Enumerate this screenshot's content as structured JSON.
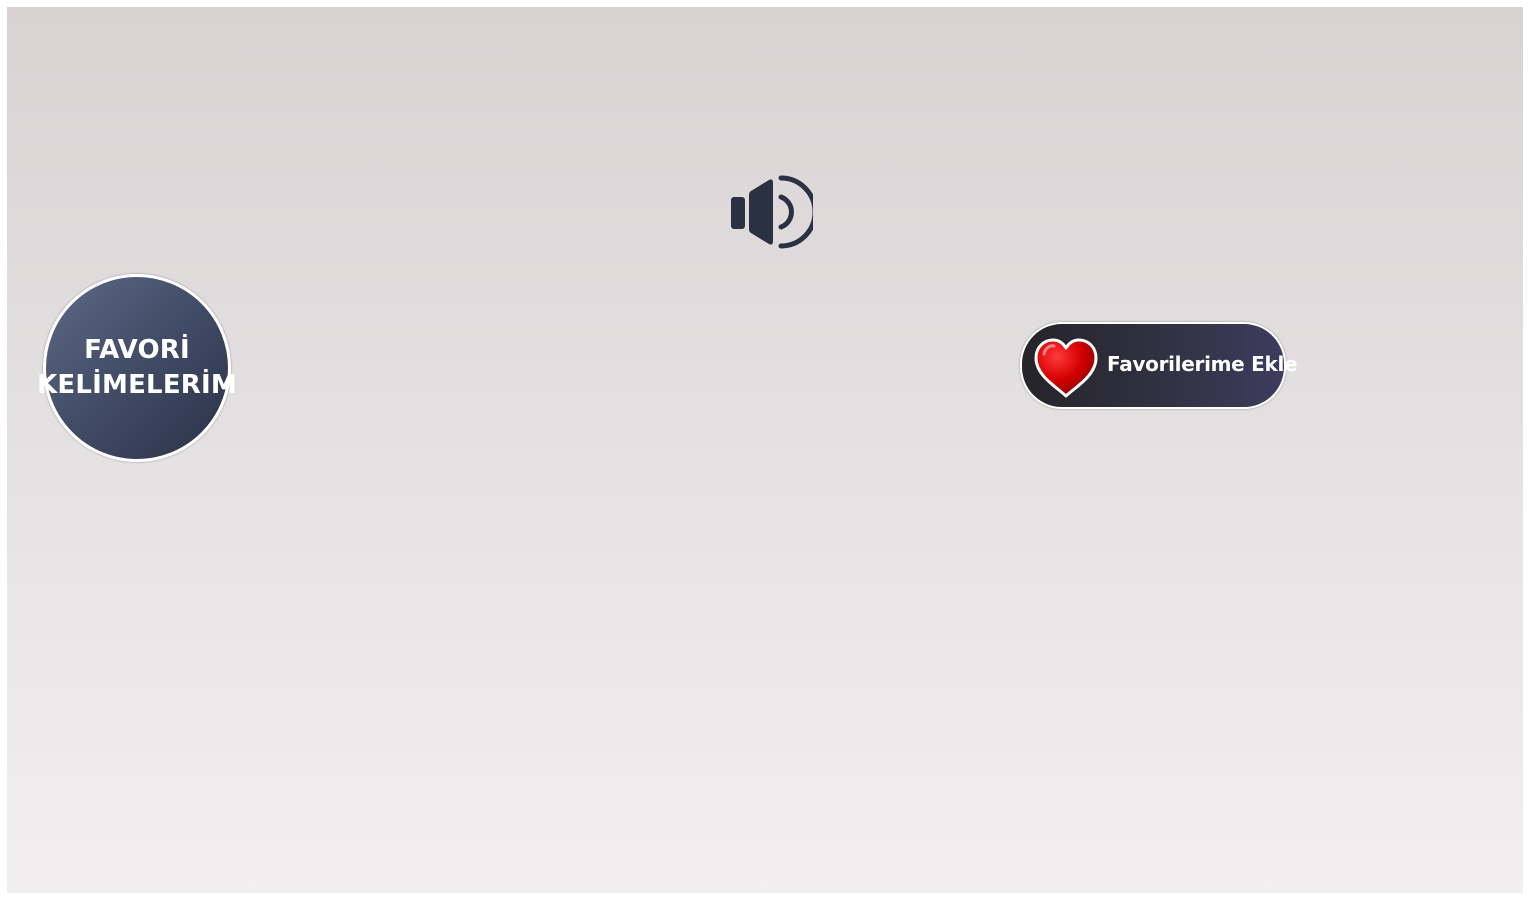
{
  "speaker": {
    "icon": "speaker-volume-icon",
    "color": "#2a3142"
  },
  "favorites_button": {
    "line1": "FAVORİ",
    "line2": "KELİMELERİM"
  },
  "add_favorite_button": {
    "icon": "heart-icon",
    "label": "Favorilerime Ekle",
    "heart_color": "#d40000"
  }
}
